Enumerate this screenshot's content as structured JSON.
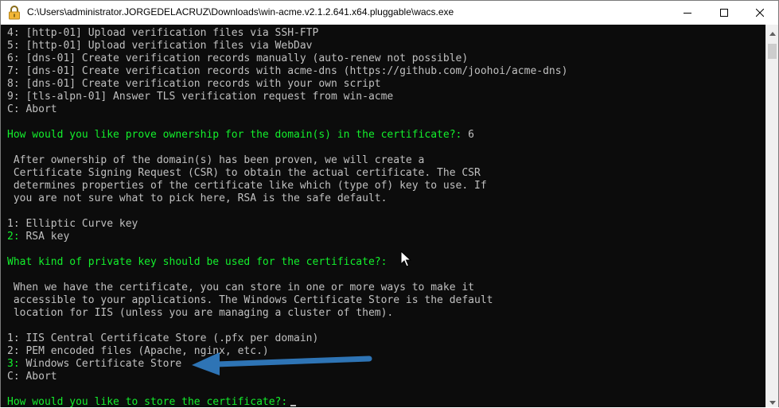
{
  "window": {
    "title": "C:\\Users\\administrator.JORGEDELACRUZ\\Downloads\\win-acme.v2.1.2.641.x64.pluggable\\wacs.exe",
    "icons": {
      "app": "padlock-icon",
      "minimize": "minimize-icon",
      "maximize": "maximize-icon",
      "close": "close-icon"
    }
  },
  "console": {
    "lines": [
      {
        "text": "4: [http-01] Upload verification files via SSH-FTP"
      },
      {
        "text": "5: [http-01] Upload verification files via WebDav"
      },
      {
        "text": "6: [dns-01] Create verification records manually (auto-renew not possible)"
      },
      {
        "text": "7: [dns-01] Create verification records with acme-dns (https://github.com/joohoi/acme-dns)"
      },
      {
        "text": "8: [dns-01] Create verification records with your own script"
      },
      {
        "text": "9: [tls-alpn-01] Answer TLS verification request from win-acme"
      },
      {
        "text": "C: Abort"
      },
      {
        "text": ""
      },
      {
        "prompt": "How would you like prove ownership for the domain(s) in the certificate?:",
        "answer": " 6"
      },
      {
        "text": ""
      },
      {
        "text": " After ownership of the domain(s) has been proven, we will create a"
      },
      {
        "text": " Certificate Signing Request (CSR) to obtain the actual certificate. The CSR"
      },
      {
        "text": " determines properties of the certificate like which (type of) key to use. If"
      },
      {
        "text": " you are not sure what to pick here, RSA is the safe default."
      },
      {
        "text": ""
      },
      {
        "text": "1: Elliptic Curve key"
      },
      {
        "key": "2:",
        "text": " RSA key"
      },
      {
        "text": ""
      },
      {
        "prompt": "What kind of private key should be used for the certificate?:",
        "answer": ""
      },
      {
        "text": ""
      },
      {
        "text": " When we have the certificate, you can store in one or more ways to make it"
      },
      {
        "text": " accessible to your applications. The Windows Certificate Store is the default"
      },
      {
        "text": " location for IIS (unless you are managing a cluster of them)."
      },
      {
        "text": ""
      },
      {
        "text": "1: IIS Central Certificate Store (.pfx per domain)"
      },
      {
        "text": "2: PEM encoded files (Apache, nginx, etc.)"
      },
      {
        "key": "3:",
        "text": " Windows Certificate Store"
      },
      {
        "text": "C: Abort"
      },
      {
        "text": ""
      },
      {
        "prompt": "How would you like to store the certificate?:",
        "answer": ""
      }
    ]
  },
  "colors": {
    "console_bg": "#0c0c0c",
    "console_text": "#c0c0c0",
    "prompt_green": "#13f02c",
    "annotation_arrow": "#2e74b5"
  },
  "annotation": {
    "icon": "arrow-left-icon"
  },
  "scrollbar": {
    "icons": {
      "up": "scroll-up-icon",
      "down": "scroll-down-icon"
    }
  }
}
